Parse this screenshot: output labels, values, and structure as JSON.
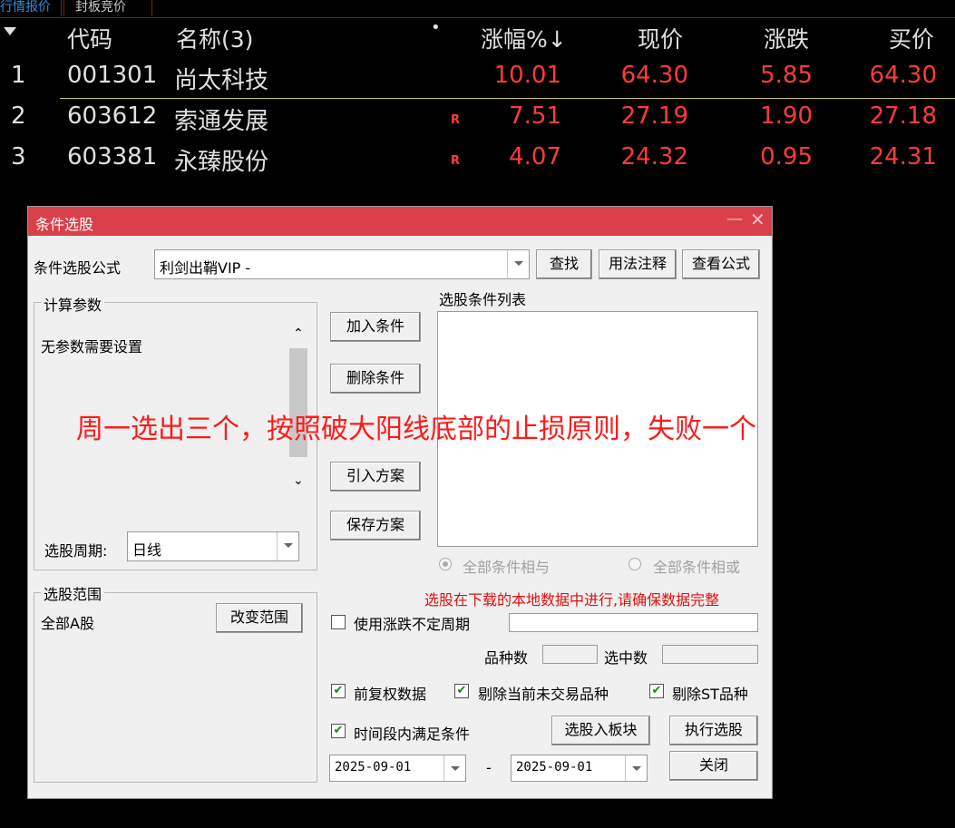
{
  "tabs": [
    "行情报价",
    "封板竞价"
  ],
  "table": {
    "headers": {
      "code": "代码",
      "name": "名称(3)",
      "dot": "•",
      "change_pct": "涨幅%↓",
      "price": "现价",
      "change": "涨跌",
      "bid": "买价"
    },
    "rows": [
      {
        "num": "1",
        "code": "001301",
        "name": "尚太科技",
        "flag": "",
        "change_pct": "10.01",
        "price": "64.30",
        "change": "5.85",
        "bid": "64.30"
      },
      {
        "num": "2",
        "code": "603612",
        "name": "索通发展",
        "flag": "R",
        "change_pct": "7.51",
        "price": "27.19",
        "change": "1.90",
        "bid": "27.18"
      },
      {
        "num": "3",
        "code": "603381",
        "name": "永臻股份",
        "flag": "R",
        "change_pct": "4.07",
        "price": "24.32",
        "change": "0.95",
        "bid": "24.31"
      }
    ]
  },
  "dialog": {
    "title": "条件选股",
    "minimize": "—",
    "close": "✕",
    "formula_label": "条件选股公式",
    "formula_value": "利剑出鞘VIP  -",
    "find": "查找",
    "usage_notes": "用法注释",
    "view_formula": "查看公式",
    "params_group": "计算参数",
    "params_text": "无参数需要设置",
    "add_condition": "加入条件",
    "delete_condition": "删除条件",
    "import_plan": "引入方案",
    "save_plan": "保存方案",
    "list_title": "选股条件列表",
    "period_label": "选股周期:",
    "period_value": "日线",
    "and_all": "全部条件相与",
    "or_all": "全部条件相或",
    "warning": "选股在下载的本地数据中进行,请确保数据完整",
    "range_group": "选股范围",
    "range_value": "全部A股",
    "change_range": "改变范围",
    "use_uncertain": "使用涨跌不定周期",
    "variety_count": "品种数",
    "selected_count": "选中数",
    "adj_data": "前复权数据",
    "exclude_untraded": "剔除当前未交易品种",
    "exclude_st": "剔除ST品种",
    "period_condition": "时间段内满足条件",
    "to_block": "选股入板块",
    "execute": "执行选股",
    "date_start": "2025-09-01",
    "date_sep": "-",
    "date_end": "2025-09-01",
    "close_btn": "关闭"
  },
  "annotation": "周一选出三个，按照破大阳线底部的止损原则，失败一个",
  "colors": {
    "up": "#ff3b3b",
    "title_bar": "#d9404a",
    "annotation": "#ff1a1a"
  }
}
